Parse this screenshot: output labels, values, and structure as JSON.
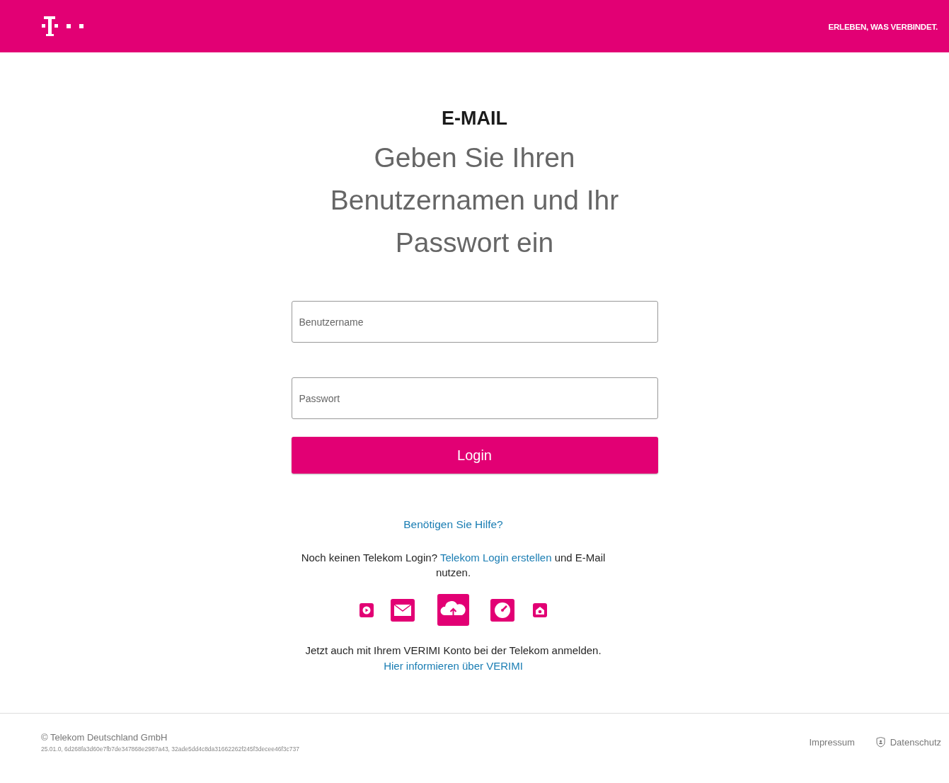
{
  "header": {
    "slogan": "ERLEBEN, WAS VERBINDET."
  },
  "login": {
    "service": "E-MAIL",
    "heading": "Geben Sie Ihren Benutzernamen und Ihr Passwort ein",
    "fields": [
      {
        "placeholder": "Benutzername",
        "kind": "text"
      },
      {
        "placeholder": "Passwort",
        "kind": "password"
      }
    ],
    "button": "Login",
    "help_link": "Benötigen Sie Hilfe?",
    "register": {
      "before": "Noch keinen Telekom Login?",
      "link": "Telekom Login erstellen",
      "after": "und E-Mail nutzen."
    },
    "verimi": {
      "text": "Jetzt auch mit Ihrem VERIMI Konto bei der Telekom anmelden.",
      "link": "Hier informieren über VERIMI"
    }
  },
  "footer": {
    "copyright": "© Telekom Deutschland GmbH",
    "version": "25.01.0, 6d268fa3d60e7fb7de347868e2987a43, 32ade5dd4c8da31662262f245f3decee46f3c737",
    "links": [
      "Impressum",
      "Datenschutz"
    ]
  }
}
